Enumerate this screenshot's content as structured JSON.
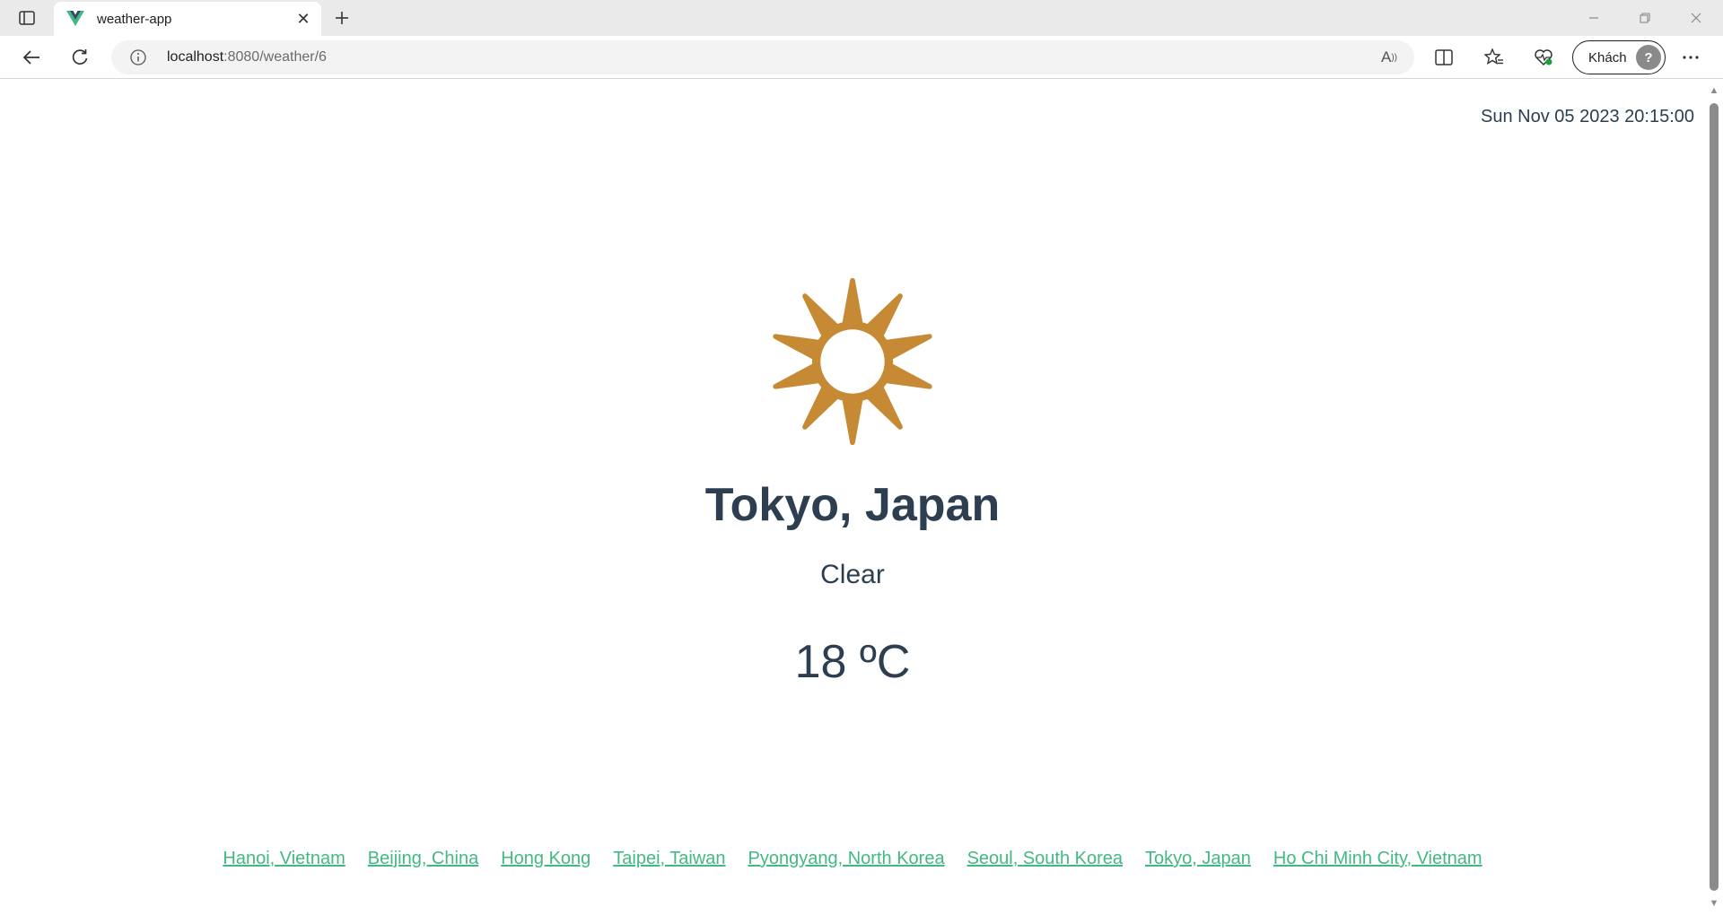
{
  "browser": {
    "tab_title": "weather-app",
    "url_host": "localhost",
    "url_path": ":8080/weather/6",
    "profile_label": "Khách",
    "accent_color": "#42b983"
  },
  "page": {
    "datetime": "Sun Nov 05 2023 20:15:00",
    "weather_icon": "sun-icon",
    "icon_color": "#c68a35",
    "location": "Tokyo, Japan",
    "condition": "Clear",
    "temperature": "18 ºC",
    "cities": [
      "Hanoi, Vietnam",
      "Beijing, China",
      "Hong Kong",
      "Taipei, Taiwan",
      "Pyongyang, North Korea",
      "Seoul, South Korea",
      "Tokyo, Japan",
      "Ho Chi Minh City, Vietnam"
    ]
  }
}
